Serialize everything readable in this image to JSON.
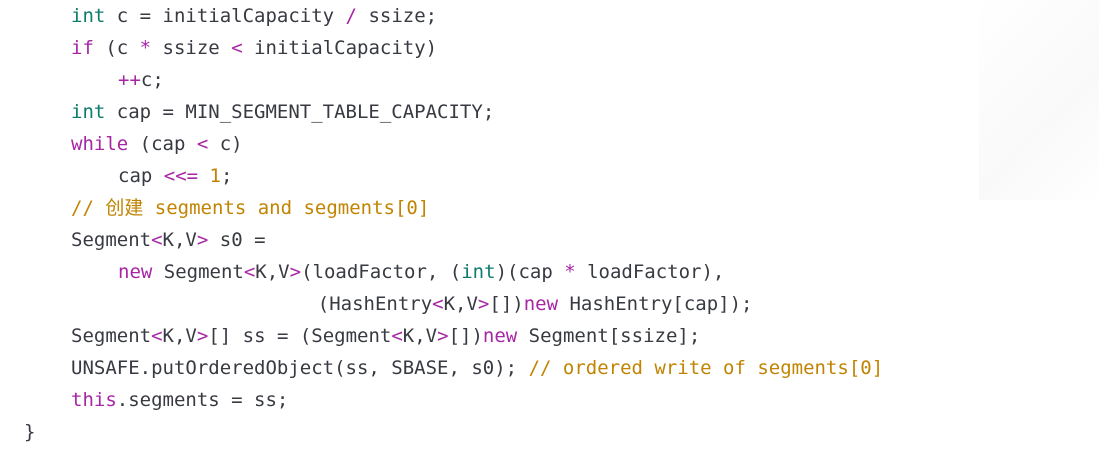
{
  "editor": {
    "language": "java",
    "colors": {
      "background": "#ffffff",
      "plain": "#383a42",
      "keyword": "#a626a4",
      "type": "#0e7c6b",
      "number": "#c18401",
      "comment": "#c18401"
    },
    "lines": [
      {
        "indent": 4,
        "tokens": [
          [
            "type",
            "int"
          ],
          [
            "plain",
            " c = initialCapacity "
          ],
          [
            "op",
            "/"
          ],
          [
            "plain",
            " ssize;"
          ]
        ]
      },
      {
        "indent": 4,
        "tokens": [
          [
            "kw",
            "if"
          ],
          [
            "plain",
            " (c "
          ],
          [
            "op",
            "*"
          ],
          [
            "plain",
            " ssize "
          ],
          [
            "op",
            "<"
          ],
          [
            "plain",
            " initialCapacity)"
          ]
        ]
      },
      {
        "indent": 8,
        "tokens": [
          [
            "op",
            "++"
          ],
          [
            "plain",
            "c;"
          ]
        ]
      },
      {
        "indent": 4,
        "tokens": [
          [
            "type",
            "int"
          ],
          [
            "plain",
            " cap = MIN_SEGMENT_TABLE_CAPACITY;"
          ]
        ]
      },
      {
        "indent": 4,
        "tokens": [
          [
            "kw",
            "while"
          ],
          [
            "plain",
            " (cap "
          ],
          [
            "op",
            "<"
          ],
          [
            "plain",
            " c)"
          ]
        ]
      },
      {
        "indent": 8,
        "tokens": [
          [
            "plain",
            "cap "
          ],
          [
            "op",
            "<<="
          ],
          [
            "plain",
            " "
          ],
          [
            "num",
            "1"
          ],
          [
            "plain",
            ";"
          ]
        ]
      },
      {
        "indent": 4,
        "tokens": [
          [
            "comment",
            "// 创建 segments and segments[0]"
          ]
        ]
      },
      {
        "indent": 4,
        "tokens": [
          [
            "plain",
            "Segment"
          ],
          [
            "op",
            "<"
          ],
          [
            "plain",
            "K,V"
          ],
          [
            "op",
            ">"
          ],
          [
            "plain",
            " s0 ="
          ]
        ]
      },
      {
        "indent": 8,
        "tokens": [
          [
            "kw",
            "new"
          ],
          [
            "plain",
            " Segment"
          ],
          [
            "op",
            "<"
          ],
          [
            "plain",
            "K,V"
          ],
          [
            "op",
            ">"
          ],
          [
            "plain",
            "(loadFactor, ("
          ],
          [
            "type",
            "int"
          ],
          [
            "plain",
            ")(cap "
          ],
          [
            "op",
            "*"
          ],
          [
            "plain",
            " loadFactor),"
          ]
        ]
      },
      {
        "indent": 25,
        "tokens": [
          [
            "plain",
            "(HashEntry"
          ],
          [
            "op",
            "<"
          ],
          [
            "plain",
            "K,V"
          ],
          [
            "op",
            ">"
          ],
          [
            "plain",
            "[])"
          ],
          [
            "kw",
            "new"
          ],
          [
            "plain",
            " HashEntry[cap]);"
          ]
        ]
      },
      {
        "indent": 4,
        "tokens": [
          [
            "plain",
            "Segment"
          ],
          [
            "op",
            "<"
          ],
          [
            "plain",
            "K,V"
          ],
          [
            "op",
            ">"
          ],
          [
            "plain",
            "[] ss = (Segment"
          ],
          [
            "op",
            "<"
          ],
          [
            "plain",
            "K,V"
          ],
          [
            "op",
            ">"
          ],
          [
            "plain",
            "[])"
          ],
          [
            "kw",
            "new"
          ],
          [
            "plain",
            " Segment[ssize];"
          ]
        ]
      },
      {
        "indent": 4,
        "tokens": [
          [
            "plain",
            "UNSAFE.putOrderedObject(ss, SBASE, s0); "
          ],
          [
            "comment",
            "// ordered write of segments[0]"
          ]
        ]
      },
      {
        "indent": 4,
        "tokens": [
          [
            "kw",
            "this"
          ],
          [
            "plain",
            ".segments = ss;"
          ]
        ]
      },
      {
        "indent": 0,
        "tokens": [
          [
            "plain",
            "}"
          ]
        ]
      }
    ]
  }
}
